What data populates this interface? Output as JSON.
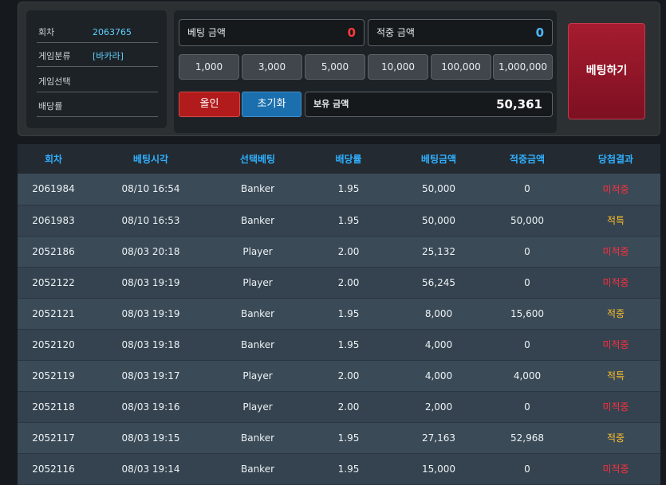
{
  "info": [
    {
      "key": "회차",
      "value": "2063765"
    },
    {
      "key": "게임분류",
      "value": "[바카라]"
    },
    {
      "key": "게임선택",
      "value": ""
    },
    {
      "key": "배당률",
      "value": ""
    }
  ],
  "bet_amount": {
    "label": "베팅 금액",
    "value": "0"
  },
  "hit_amount": {
    "label": "적중 금액",
    "value": "0"
  },
  "chips": [
    "1,000",
    "3,000",
    "5,000",
    "10,000",
    "100,000",
    "1,000,000"
  ],
  "allin_label": "올인",
  "reset_label": "초기화",
  "balance": {
    "label": "보유 금액",
    "value": "50,361"
  },
  "bet_button_label": "베팅하기",
  "table": {
    "headers": [
      "회차",
      "베팅시각",
      "선택베팅",
      "배당률",
      "베팅금액",
      "적중금액",
      "당첨결과"
    ],
    "rows": [
      [
        "2061984",
        "08/10 16:54",
        "Banker",
        "1.95",
        "50,000",
        "0",
        "미적중"
      ],
      [
        "2061983",
        "08/10 16:53",
        "Banker",
        "1.95",
        "50,000",
        "50,000",
        "적특"
      ],
      [
        "2052186",
        "08/03 20:18",
        "Player",
        "2.00",
        "25,132",
        "0",
        "미적중"
      ],
      [
        "2052122",
        "08/03 19:19",
        "Player",
        "2.00",
        "56,245",
        "0",
        "미적중"
      ],
      [
        "2052121",
        "08/03 19:19",
        "Banker",
        "1.95",
        "8,000",
        "15,600",
        "적중"
      ],
      [
        "2052120",
        "08/03 19:18",
        "Banker",
        "1.95",
        "4,000",
        "0",
        "미적중"
      ],
      [
        "2052119",
        "08/03 19:17",
        "Player",
        "2.00",
        "4,000",
        "4,000",
        "적특"
      ],
      [
        "2052118",
        "08/03 19:16",
        "Player",
        "2.00",
        "2,000",
        "0",
        "미적중"
      ],
      [
        "2052117",
        "08/03 19:15",
        "Banker",
        "1.95",
        "27,163",
        "52,968",
        "적중"
      ],
      [
        "2052116",
        "08/03 19:14",
        "Banker",
        "1.95",
        "15,000",
        "0",
        "미적중"
      ]
    ]
  },
  "colors": {
    "accent": "#2fb0ff",
    "lose": "#ff2f3f",
    "win": "#ffc02a",
    "bet_button": "#a51c2f",
    "amount_value": "#ff3b3b",
    "hit_value": "#4db8ff"
  }
}
